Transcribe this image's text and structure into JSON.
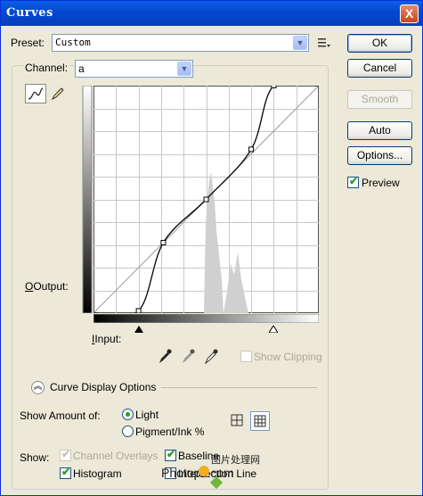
{
  "window": {
    "title": "Curves",
    "close": "X"
  },
  "preset": {
    "label": "Preset:",
    "value": "Custom"
  },
  "channel": {
    "label": "Channel:",
    "value": "a"
  },
  "buttons": {
    "ok": "OK",
    "cancel": "Cancel",
    "smooth": "Smooth",
    "auto": "Auto",
    "options": "Options..."
  },
  "preview": {
    "label": "Preview",
    "checked": true
  },
  "graph": {
    "output_label": "Output:",
    "input_label": "Input:",
    "show_clipping": "Show Clipping"
  },
  "curve_display": {
    "label": "Curve Display Options"
  },
  "show_amount": {
    "label": "Show Amount of:",
    "light": "Light",
    "pigment": "Pigment/Ink %"
  },
  "show": {
    "label": "Show:",
    "channel_overlays": "Channel Overlays",
    "baseline": "Baseline",
    "histogram": "Histogram",
    "intersection": "Intersection Line"
  },
  "watermark": {
    "site": "图片处理网",
    "domain": "Photops.com"
  },
  "curve": {
    "points": [
      [
        0,
        0
      ],
      [
        20,
        1
      ],
      [
        31,
        31
      ],
      [
        50,
        50
      ],
      [
        70,
        72
      ],
      [
        80,
        100
      ],
      [
        100,
        100
      ]
    ]
  }
}
